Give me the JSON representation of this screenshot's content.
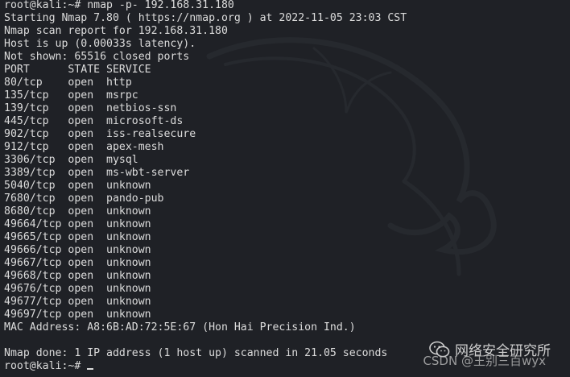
{
  "terminal": {
    "lines": [
      "root@kali:~# nmap -p- 192.168.31.180",
      "Starting Nmap 7.80 ( https://nmap.org ) at 2022-11-05 23:03 CST",
      "Nmap scan report for 192.168.31.180",
      "Host is up (0.00033s latency).",
      "Not shown: 65516 closed ports",
      "PORT      STATE SERVICE",
      "80/tcp    open  http",
      "135/tcp   open  msrpc",
      "139/tcp   open  netbios-ssn",
      "445/tcp   open  microsoft-ds",
      "902/tcp   open  iss-realsecure",
      "912/tcp   open  apex-mesh",
      "3306/tcp  open  mysql",
      "3389/tcp  open  ms-wbt-server",
      "5040/tcp  open  unknown",
      "7680/tcp  open  pando-pub",
      "8680/tcp  open  unknown",
      "49664/tcp open  unknown",
      "49665/tcp open  unknown",
      "49666/tcp open  unknown",
      "49667/tcp open  unknown",
      "49668/tcp open  unknown",
      "49676/tcp open  unknown",
      "49677/tcp open  unknown",
      "49697/tcp open  unknown",
      "MAC Address: A8:6B:AD:72:5E:67 (Hon Hai Precision Ind.)",
      "",
      "Nmap done: 1 IP address (1 host up) scanned in 21.05 seconds"
    ],
    "prompt": "root@kali:~# "
  },
  "watermark": {
    "account": "网络安全研究所",
    "csdn": "CSDN @王别三百wyx"
  },
  "colors": {
    "background": "#1f2126",
    "text": "#dcdcdc"
  },
  "icons": {
    "background_logo": "kali-dragon-icon",
    "wechat": "wechat-icon"
  }
}
